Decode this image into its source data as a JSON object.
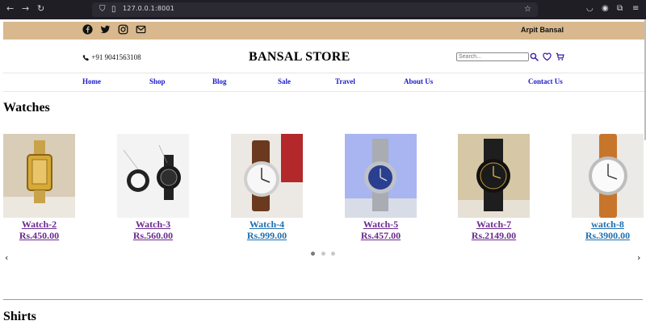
{
  "browser": {
    "url": "127.0.0.1:8001"
  },
  "topbar": {
    "user_name": "Arpit Bansal",
    "social_icons": [
      "facebook-icon",
      "twitter-icon",
      "instagram-icon",
      "mail-icon"
    ]
  },
  "header": {
    "phone": "+91 9041563108",
    "brand": "BANSAL STORE",
    "search_placeholder": "Search..."
  },
  "menu": {
    "items": [
      "Home",
      "Shop",
      "Blog",
      "Sale",
      "Travel",
      "About Us",
      "Contact Us"
    ]
  },
  "watches": {
    "title": "Watches",
    "products": [
      {
        "title": "Watch-2",
        "price": "Rs.450.00",
        "link_color": "#6b2a8f"
      },
      {
        "title": "Watch-3",
        "price": "Rs.560.00",
        "link_color": "#6b2a8f"
      },
      {
        "title": "Watch-4",
        "price": "Rs.999.00",
        "link_color": "#1f6fae"
      },
      {
        "title": "Watch-5",
        "price": "Rs.457.00",
        "link_color": "#6b2a8f"
      },
      {
        "title": "Watch-7",
        "price": "Rs.2149.00",
        "link_color": "#6b2a8f"
      },
      {
        "title": "watch-8",
        "price": "Rs.3900.00",
        "link_color": "#1f6fae"
      }
    ],
    "prev_arrow": "‹",
    "next_arrow": "›"
  },
  "shirts": {
    "title": "Shirts"
  },
  "colors": {
    "topbar": "#d8b88c",
    "menu_link": "#1a1acb",
    "visited_link": "#6b2a8f",
    "link": "#1f6fae"
  }
}
